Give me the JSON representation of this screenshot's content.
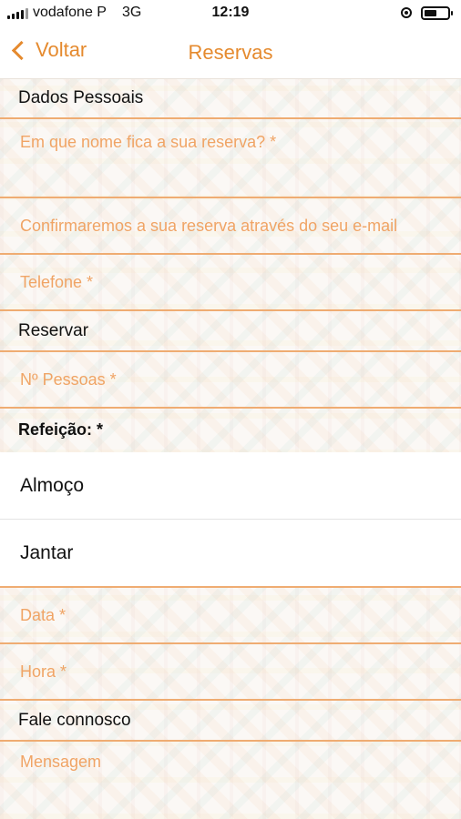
{
  "status_bar": {
    "carrier": "vodafone P",
    "network": "3G",
    "time": "12:19",
    "battery_level": 0.55
  },
  "nav": {
    "back_label": "Voltar",
    "title": "Reservas"
  },
  "sections": {
    "personal": "Dados Pessoais",
    "reserve": "Reservar",
    "meal": "Refeição: *",
    "contact": "Fale connosco"
  },
  "fields": {
    "name": "Em que nome fica a sua reserva? *",
    "email": "Confirmaremos a sua reserva através do seu e-mail",
    "phone": "Telefone *",
    "people": "Nº Pessoas *",
    "date": "Data *",
    "time": "Hora *",
    "message": "Mensagem"
  },
  "meal_options": [
    "Almoço",
    "Jantar"
  ],
  "colors": {
    "accent": "#e58a2e",
    "placeholder": "#f0a465",
    "divider": "#efac72"
  }
}
